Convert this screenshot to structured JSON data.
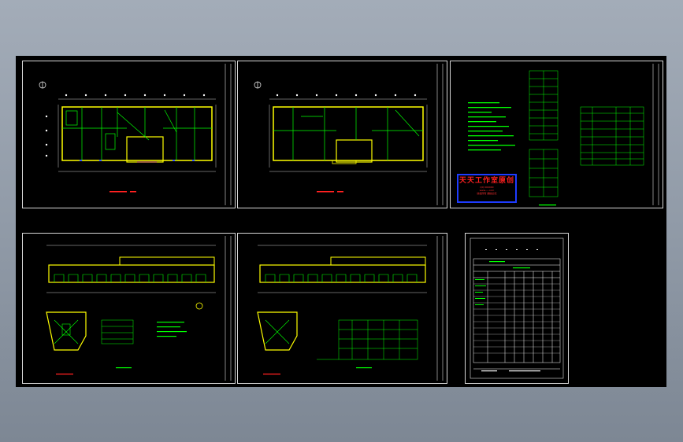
{
  "app": {
    "background_color": "#9aa3ae",
    "canvas_color": "#000000"
  },
  "stamp": {
    "title": "天天工作室原创",
    "line1": "QQ 000000",
    "line2": "www.---.com",
    "line3": "版权所有 翻版必究",
    "border_color": "#1e3cff",
    "text_color": "#ff2020"
  },
  "sheets": [
    {
      "name": "sheet-1",
      "kind": "floor-plan"
    },
    {
      "name": "sheet-2",
      "kind": "floor-plan"
    },
    {
      "name": "sheet-3",
      "kind": "notes-and-tables"
    },
    {
      "name": "sheet-4",
      "kind": "elevation-and-details"
    },
    {
      "name": "sheet-5",
      "kind": "elevation-and-details"
    },
    {
      "name": "sheet-6",
      "kind": "schedule-table"
    }
  ],
  "colors": {
    "wall": "#ffff00",
    "line": "#00ff00",
    "dim": "#ffffff",
    "accent": "#ff00ff",
    "red": "#ff2020"
  }
}
